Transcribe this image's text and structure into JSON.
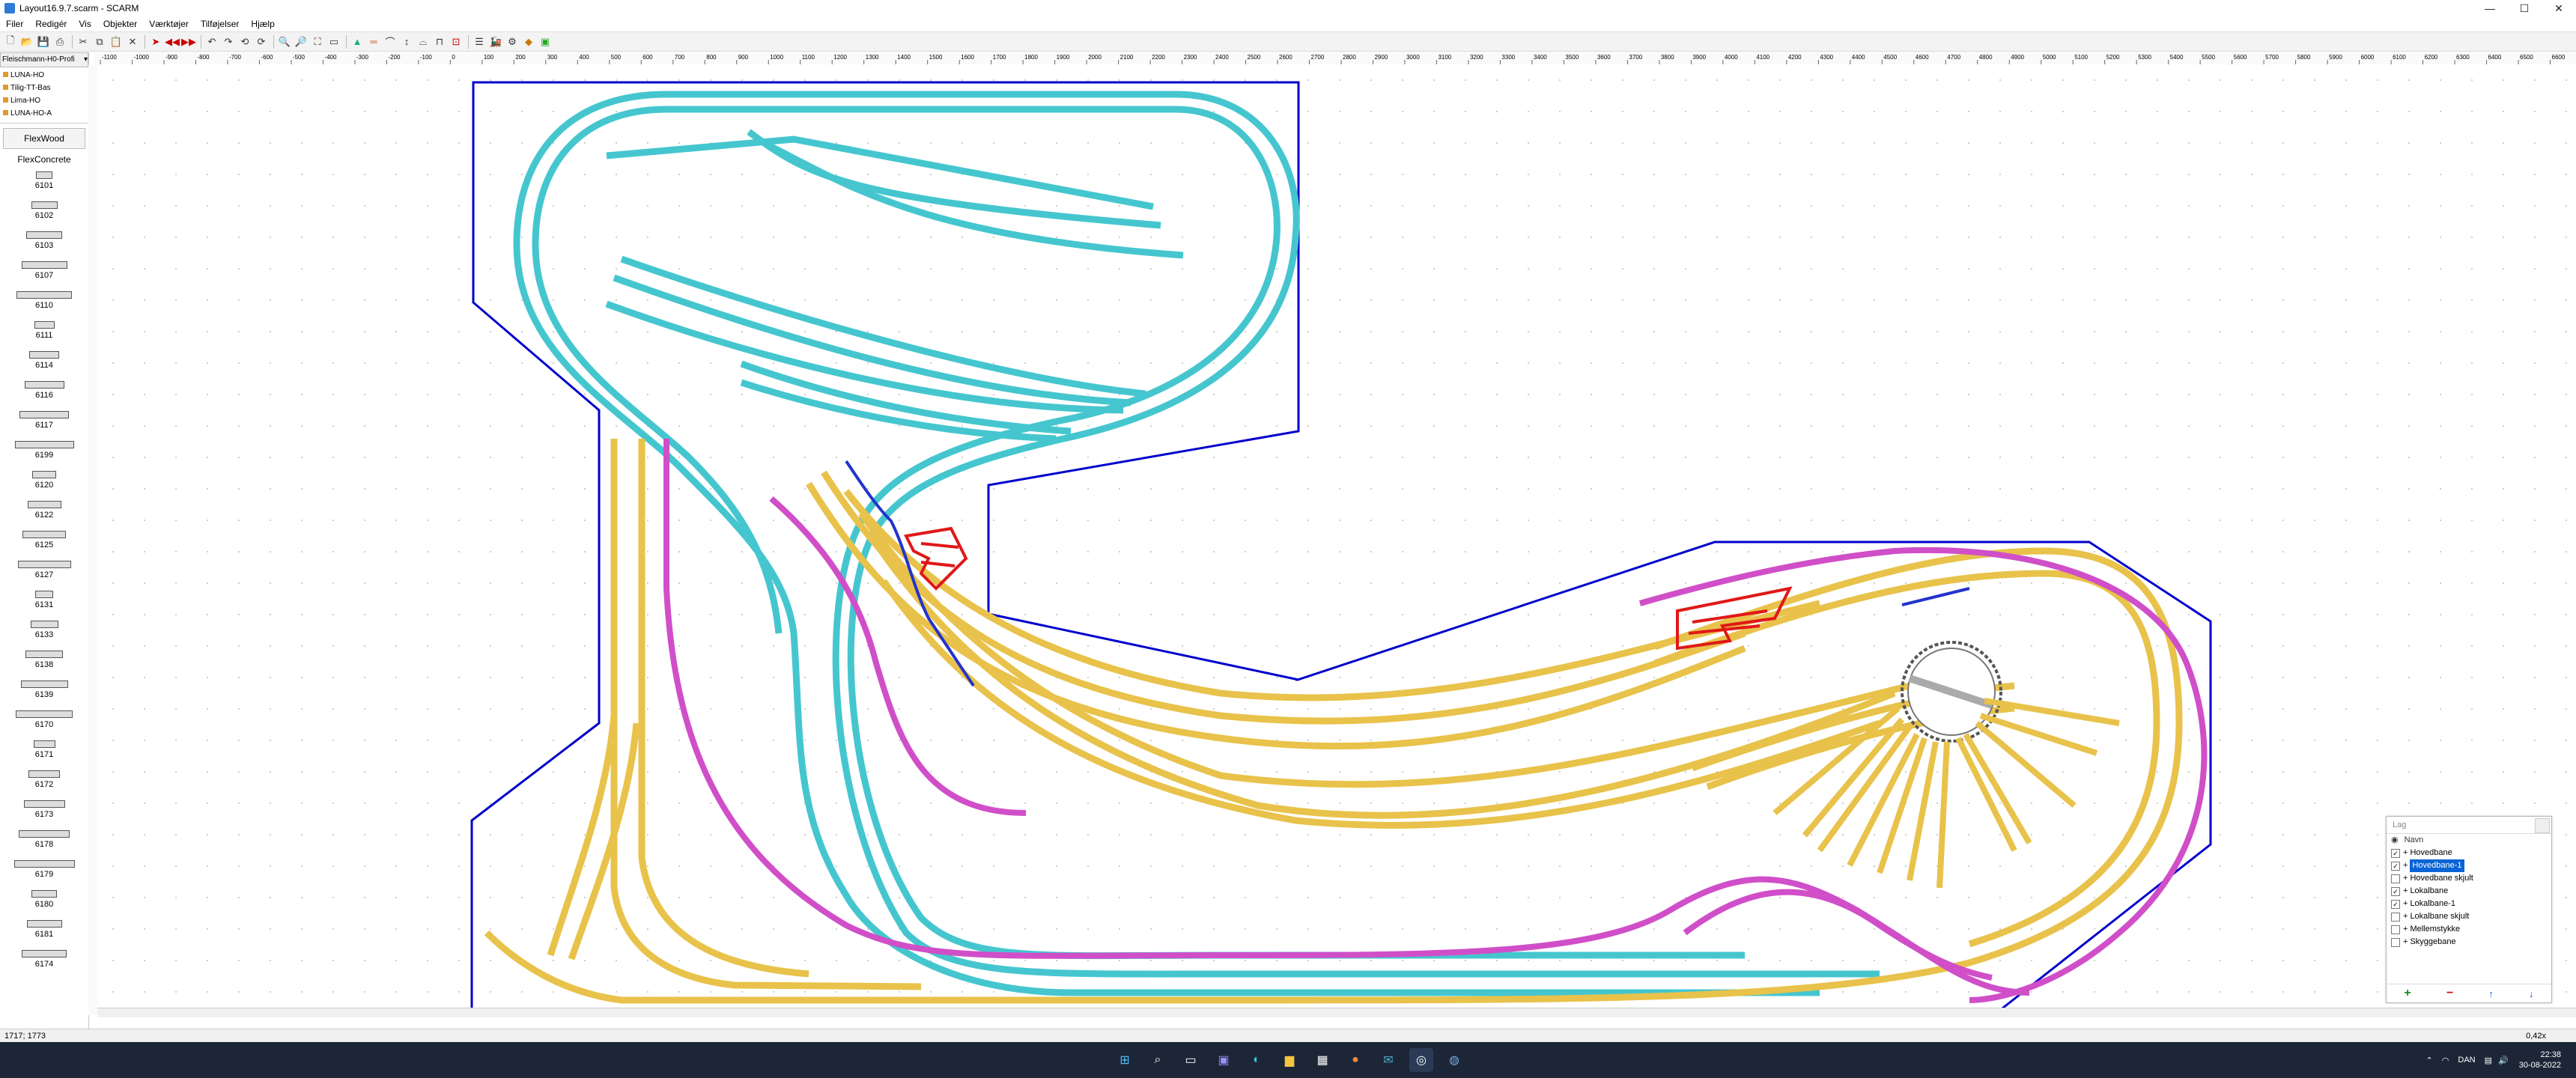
{
  "window": {
    "title": "Layout16.9.7.scarm - SCARM",
    "minimize": "—",
    "maximize": "☐",
    "close": "✕"
  },
  "menu": [
    "Filer",
    "Redigér",
    "Vis",
    "Objekter",
    "Værktøjer",
    "Tilføjelser",
    "Hjælp"
  ],
  "sidebar": {
    "library": "Fleischmann-H0-Profi",
    "libraries": [
      "LUNA-HO",
      "Tilig-TT-Bas",
      "Lima-HO",
      "LUNA-HO-A"
    ],
    "categories": [
      "FlexWood",
      "FlexConcrete"
    ],
    "parts": [
      "6101",
      "6102",
      "6103",
      "6107",
      "6110",
      "6111",
      "6114",
      "6116",
      "6117",
      "6199",
      "6120",
      "6122",
      "6125",
      "6127",
      "6131",
      "6133",
      "6138",
      "6139",
      "6170",
      "6171",
      "6172",
      "6173",
      "6178",
      "6179",
      "6180",
      "6181",
      "6174"
    ]
  },
  "ruler": {
    "top_start": -1100,
    "top_end": 6600,
    "step": 100
  },
  "layers_panel": {
    "title": "Lag",
    "column": "Navn",
    "rows": [
      {
        "name": "Hovedbane",
        "checked": true,
        "selected": false
      },
      {
        "name": "Hovedbane-1",
        "checked": true,
        "selected": true
      },
      {
        "name": "Hovedbane skjult",
        "checked": false,
        "selected": false
      },
      {
        "name": "Lokalbane",
        "checked": true,
        "selected": false
      },
      {
        "name": "Lokalbane-1",
        "checked": true,
        "selected": false
      },
      {
        "name": "Lokalbane skjult",
        "checked": false,
        "selected": false
      },
      {
        "name": "Mellemstykke",
        "checked": false,
        "selected": false
      },
      {
        "name": "Skyggebane",
        "checked": false,
        "selected": false
      }
    ],
    "add": "+",
    "remove": "−",
    "up": "↑",
    "down": "↓"
  },
  "status": {
    "coords": "1717; 1773",
    "zoom": "0,42x"
  },
  "taskbar": {
    "lang": "DAN",
    "time": "22:38",
    "date": "30-08-2022"
  },
  "colors": {
    "main": "#45c6cf",
    "local": "#e8c24a",
    "hidden": "#d04fc8",
    "outline": "#0000cc",
    "sketch": "#e01818"
  }
}
